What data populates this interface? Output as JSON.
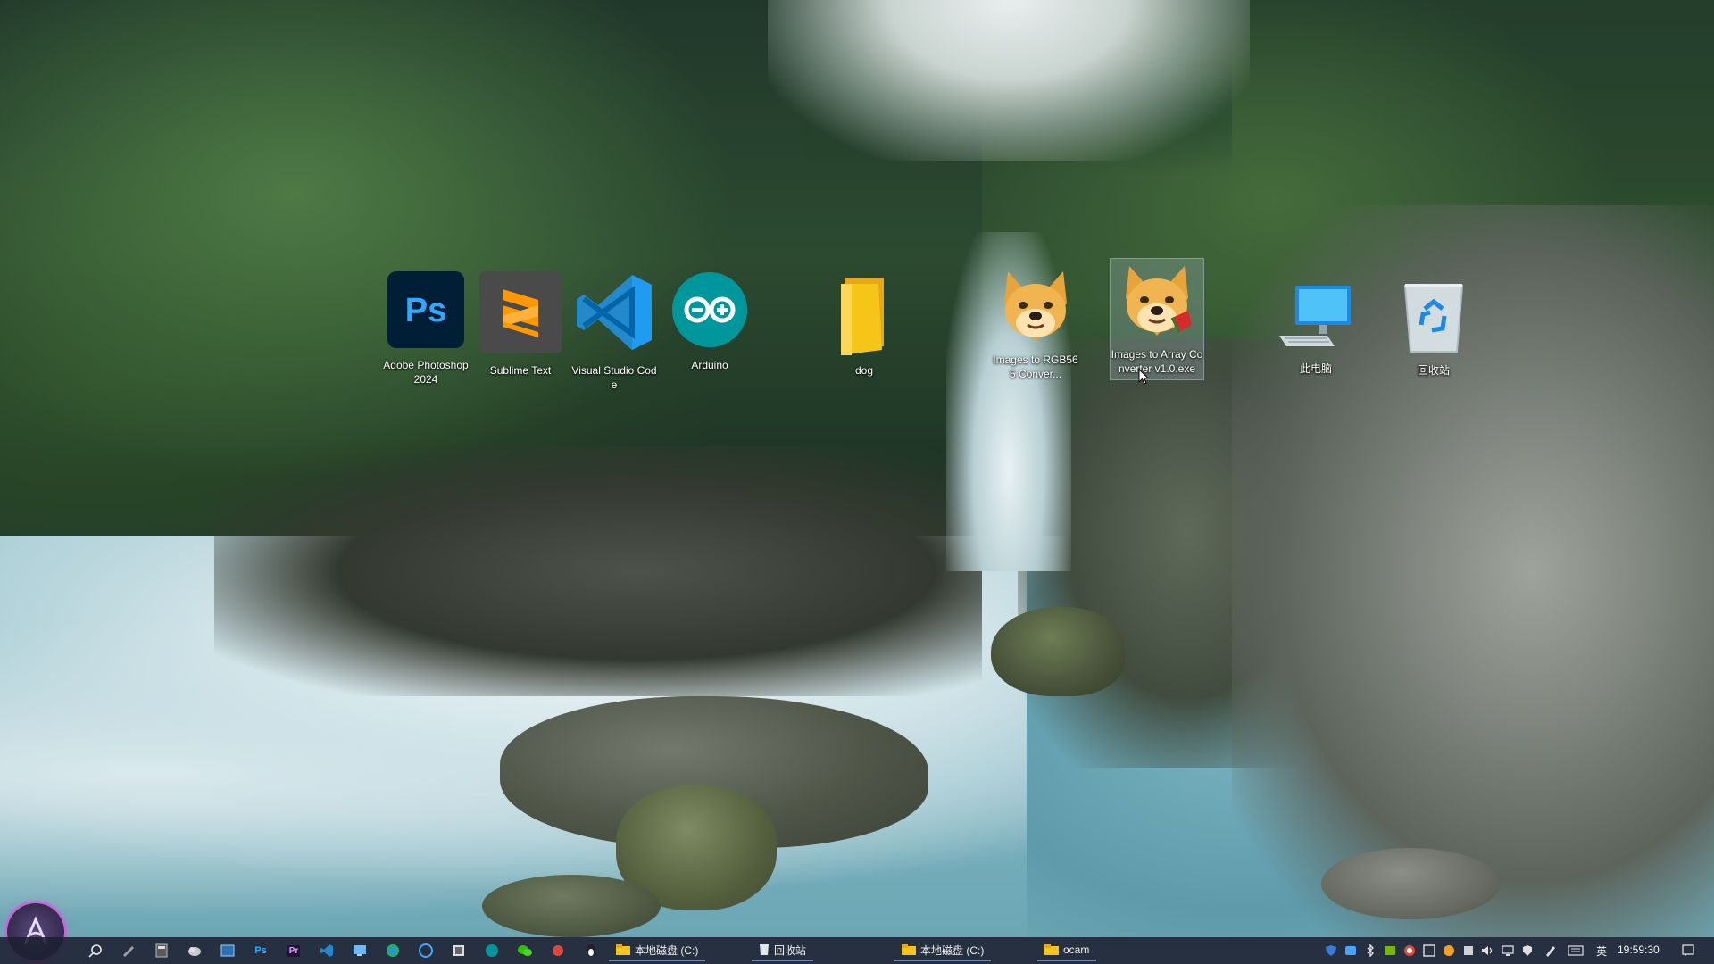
{
  "desktop": {
    "icons": [
      {
        "name": "adobe-photoshop-2024",
        "label": "Adobe Photoshop 2024",
        "glyph": "Ps"
      },
      {
        "name": "sublime-text",
        "label": "Sublime Text",
        "glyph": "S"
      },
      {
        "name": "visual-studio-code",
        "label": "Visual Studio Code"
      },
      {
        "name": "arduino",
        "label": "Arduino",
        "glyph": "∞"
      },
      {
        "name": "dog-folder",
        "label": "dog"
      },
      {
        "name": "images-to-rgb565",
        "label": "Images to RGB565 Conver..."
      },
      {
        "name": "images-to-array",
        "label": "Images to Array Converter v1.0.exe",
        "selected": true
      },
      {
        "name": "this-pc",
        "label": "此电脑"
      },
      {
        "name": "recycle-bin",
        "label": "回收站"
      }
    ]
  },
  "taskbar": {
    "windows": [
      {
        "label": "本地磁盘 (C:)",
        "icon": "folder-icon"
      },
      {
        "label": "回收站",
        "icon": "recycle-bin-icon"
      },
      {
        "label": "本地磁盘 (C:)",
        "icon": "folder-icon"
      },
      {
        "label": "ocam",
        "icon": "folder-icon"
      }
    ],
    "pinned": [
      "search-icon",
      "pen-icon",
      "calculator-icon",
      "cloud-icon",
      "window-icon",
      "photoshop-icon",
      "premiere-icon",
      "vscode-icon",
      "remote-icon",
      "edge-icon",
      "browser-icon",
      "app-icon",
      "arduino-icon",
      "wechat-icon",
      "app-icon",
      "qq-icon"
    ],
    "pinned_text": {
      "photoshop": "Ps",
      "premiere": "Pr"
    },
    "ime_label": "英",
    "clock": "19:59:30"
  },
  "colors": {
    "taskbar_bg": "#1c2030",
    "photoshop": "#31a8ff",
    "sublime": "#ff9800",
    "vscode": "#2489ca",
    "arduino": "#00979c",
    "folder": "#f5c518"
  }
}
